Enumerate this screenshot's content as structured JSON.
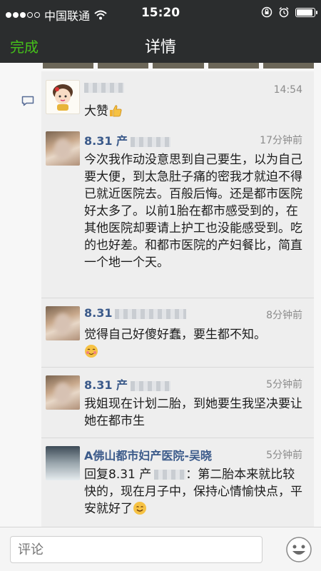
{
  "status_bar": {
    "carrier": "中国联通",
    "time": "15:20",
    "battery_level": 0.9
  },
  "nav": {
    "done_label": "完成",
    "title": "详情"
  },
  "colors": {
    "nav_background": "#2b2d2e",
    "done_green": "#45c01a",
    "name_blue": "#3b5a8a",
    "timestamp_grey": "#8c8c8c"
  },
  "like": {
    "time": "14:54",
    "text": "大赞"
  },
  "comments": [
    {
      "name": "8.31 产",
      "time": "17分钟前",
      "text": "今次我作动没意思到自己要生，以为自己要大便，到太急肚子痛的密我才就迫不得已就近医院去。百般后悔。还是都市医院好太多了。以前1胎在都市感受到的，在其他医院却要请上护工也没能感受到。吃的也好差。和都市医院的产妇餐比，简直一个地一个天。"
    },
    {
      "name": "8.31",
      "time": "8分钟前",
      "text": "觉得自己好傻好蠢，要生都不知。"
    },
    {
      "name": "8.31 产",
      "time": "5分钟前",
      "text": "我姐现在计划二胎，到她要生我坚决要让她在都市生"
    },
    {
      "name": "A佛山都市妇产医院-吴晓",
      "time": "5分钟前",
      "reply_prefix": "回复8.31 产",
      "text": "：第二胎本来就比较快的，现在月子中，保持心情愉快点，平安就好了"
    }
  ],
  "input": {
    "placeholder": "评论"
  },
  "icons": {
    "signal": "signal-dots-icon",
    "wifi": "wifi-icon",
    "lock": "rotation-lock-icon",
    "alarm": "alarm-icon",
    "battery": "battery-icon",
    "comment": "comment-bubble-icon",
    "thumbs_up": "thumbs-up-icon",
    "blush": "blush-emoji-icon",
    "smile": "smile-emoji-icon",
    "emoji_button": "emoji-face-icon"
  }
}
